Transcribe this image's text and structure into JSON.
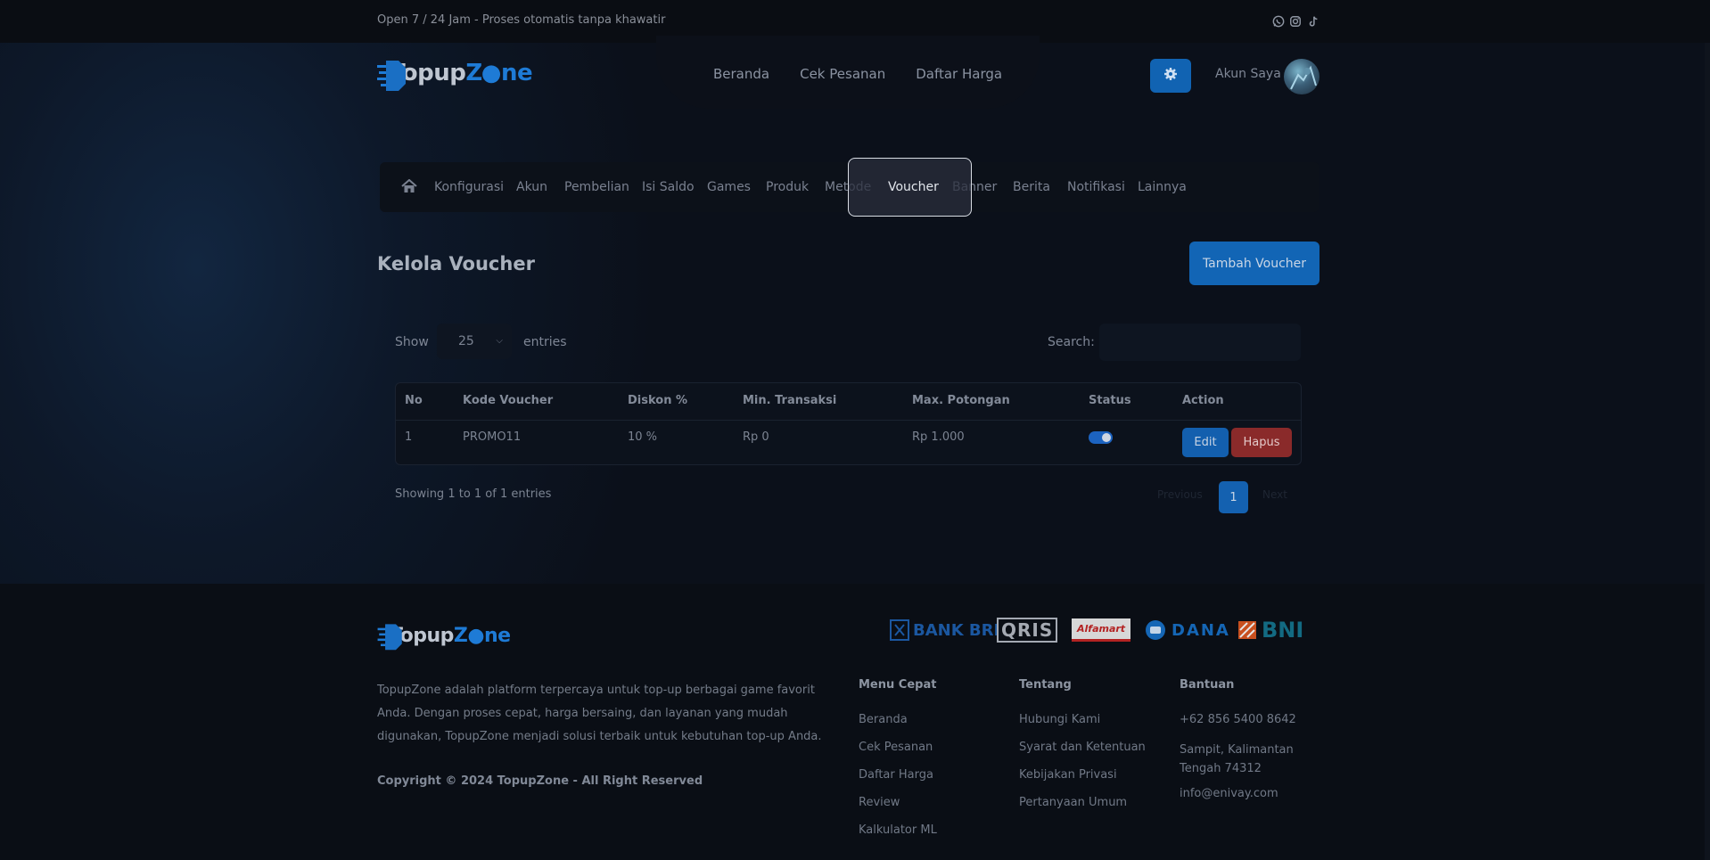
{
  "topbar": {
    "text": "Open 7 / 24 Jam - Proses otomatis tanpa khawatir",
    "social_icons": [
      "whatsapp-icon",
      "instagram-icon",
      "tiktok-icon"
    ]
  },
  "brand": {
    "part1": "Topup",
    "part2": "Z",
    "part3": "ne"
  },
  "main_nav": [
    "Beranda",
    "Cek Pesanan",
    "Daftar Harga"
  ],
  "account": {
    "label": "Akun Saya"
  },
  "admin_nav": {
    "items": [
      "Konfigurasi",
      "Akun",
      "Pembelian",
      "Isi Saldo",
      "Games",
      "Produk",
      "Metode",
      "Voucher",
      "Banner",
      "Berita",
      "Notifikasi",
      "Lainnya"
    ],
    "active": "Voucher"
  },
  "page": {
    "title": "Kelola Voucher",
    "add_button": "Tambah Voucher"
  },
  "table_controls": {
    "show_label": "Show",
    "entries_value": "25",
    "entries_label": "entries",
    "search_label": "Search:"
  },
  "table": {
    "headers": [
      "No",
      "Kode Voucher",
      "Diskon %",
      "Min. Transaksi",
      "Max. Potongan",
      "Status",
      "Action"
    ],
    "rows": [
      {
        "no": "1",
        "code": "PROMO11",
        "discount": "10 %",
        "min": "Rp 0",
        "max": "Rp 1.000",
        "status_on": true,
        "edit": "Edit",
        "delete": "Hapus"
      }
    ]
  },
  "pagination": {
    "showing": "Showing 1 to 1 of 1 entries",
    "previous": "Previous",
    "current": "1",
    "next": "Next"
  },
  "footer": {
    "description": "TopupZone adalah platform terpercaya untuk top-up berbagai game favorit Anda. Dengan proses cepat, harga bersaing, dan layanan yang mudah digunakan, TopupZone menjadi solusi terbaik untuk kebutuhan top-up Anda.",
    "copyright": "Copyright © 2024 TopupZone - All Right Reserved",
    "payments": [
      "BANK BRI",
      "QRIS",
      "Alfamart",
      "DANA",
      "BNI"
    ],
    "menu_cepat": {
      "title": "Menu Cepat",
      "links": [
        "Beranda",
        "Cek Pesanan",
        "Daftar Harga",
        "Review",
        "Kalkulator ML"
      ]
    },
    "tentang": {
      "title": "Tentang",
      "links": [
        "Hubungi Kami",
        "Syarat dan Ketentuan",
        "Kebijakan Privasi",
        "Pertanyaan Umum"
      ]
    },
    "bantuan": {
      "title": "Bantuan",
      "phone": "+62 856 5400 8642",
      "address": "Sampit, Kalimantan Tengah 74312",
      "email": "info@enivay.com"
    }
  },
  "colors": {
    "accent": "#1265b5",
    "danger": "#8a2a2a",
    "background": "#0d1320"
  }
}
